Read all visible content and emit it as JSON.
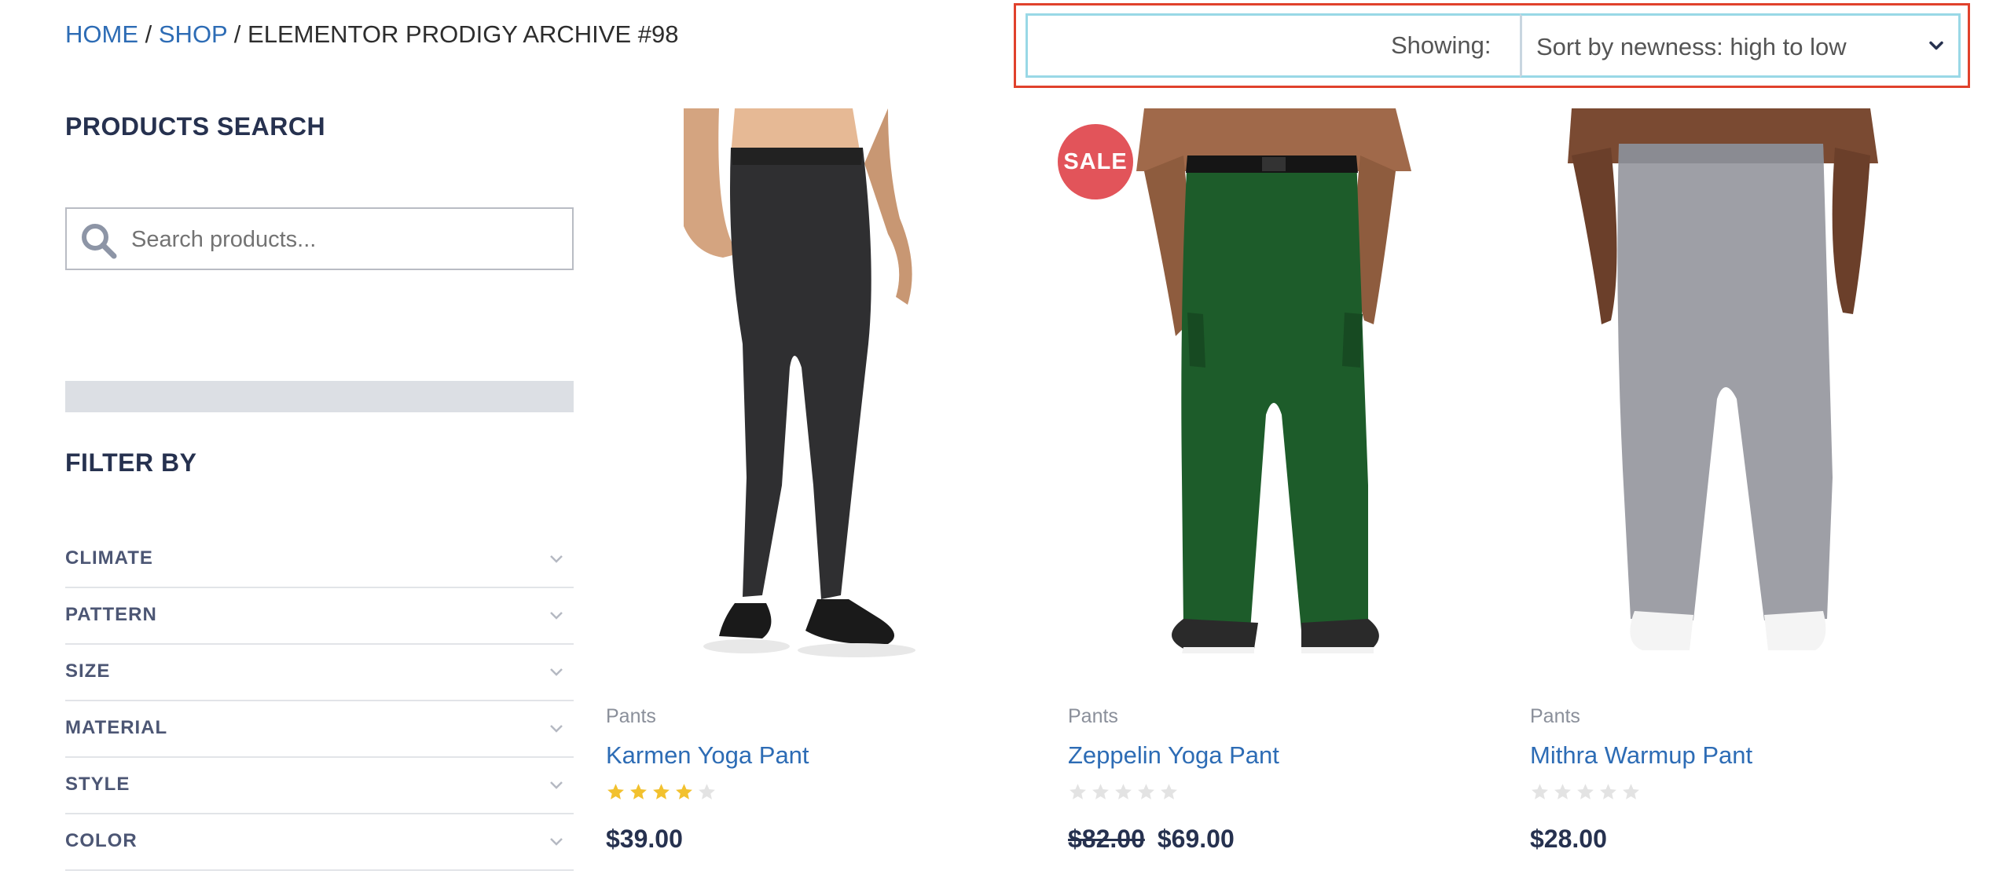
{
  "breadcrumb": {
    "home": "HOME",
    "shop": "SHOP",
    "separator": "/",
    "current": "ELEMENTOR PRODIGY ARCHIVE #98"
  },
  "toolbar": {
    "showing_label": "Showing:",
    "sort_value": "Sort by newness: high to low",
    "sort_icon": "chevron-down-icon"
  },
  "sidebar": {
    "search_title": "PRODUCTS SEARCH",
    "search_placeholder": "Search products...",
    "search_icon": "search-icon",
    "filter_title": "FILTER BY",
    "filters": [
      {
        "label": "CLIMATE"
      },
      {
        "label": "PATTERN"
      },
      {
        "label": "SIZE"
      },
      {
        "label": "MATERIAL"
      },
      {
        "label": "STYLE"
      },
      {
        "label": "COLOR"
      }
    ]
  },
  "products": [
    {
      "category": "Pants",
      "name": "Karmen Yoga Pant",
      "rating": 4,
      "price": "$39.00",
      "old_price": "",
      "sale": false
    },
    {
      "category": "Pants",
      "name": "Zeppelin Yoga Pant",
      "rating": 0,
      "price": "$69.00",
      "old_price": "$82.00",
      "sale": true,
      "badge": "SALE"
    },
    {
      "category": "Pants",
      "name": "Mithra Warmup Pant",
      "rating": 0,
      "price": "$28.00",
      "old_price": "",
      "sale": false
    }
  ],
  "colors": {
    "link": "#2d6cb5",
    "heading": "#26314f",
    "sale_badge": "#e2545a",
    "star_filled": "#f2c12e",
    "star_empty": "#e3e3e3",
    "highlight_border": "#e0412c"
  }
}
